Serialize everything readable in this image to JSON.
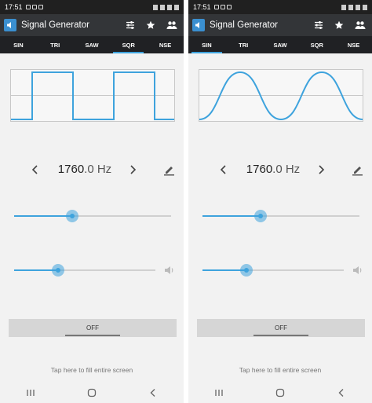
{
  "status": {
    "time": "17:51"
  },
  "app": {
    "title": "Signal Generator"
  },
  "tabs": [
    "SIN",
    "TRI",
    "SAW",
    "SQR",
    "NSE"
  ],
  "left": {
    "active_tab": "SQR",
    "waveform": "square",
    "frequency": {
      "int": "1760",
      "frac": ".0 Hz"
    },
    "freq_slider_level": 0.37,
    "volume_slider_level": 0.31,
    "off_label": "OFF",
    "hint": "Tap here to fill entire screen"
  },
  "right": {
    "active_tab": "SIN",
    "waveform": "sine",
    "frequency": {
      "int": "1760",
      "frac": ".0 Hz"
    },
    "freq_slider_level": 0.37,
    "volume_slider_level": 0.31,
    "off_label": "OFF",
    "hint": "Tap here to fill entire screen"
  },
  "colors": {
    "accent": "#3ea3dd",
    "appbar": "#333538",
    "tabbar": "#202124",
    "background": "#f2f2f2"
  },
  "icons": [
    "equalizer-icon",
    "star-icon",
    "people-icon",
    "pencil-icon",
    "chevron-left-icon",
    "chevron-right-icon",
    "volume-icon",
    "recents-icon",
    "home-icon",
    "back-icon"
  ]
}
